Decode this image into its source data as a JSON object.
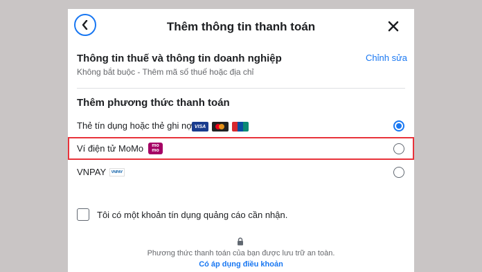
{
  "dialog": {
    "title": "Thêm thông tin thanh toán"
  },
  "tax_section": {
    "title": "Thông tin thuế và thông tin doanh nghiệp",
    "subtitle": "Không bắt buộc - Thêm mã số thuế hoặc địa chỉ",
    "edit_label": "Chỉnh sửa"
  },
  "payment_section": {
    "title": "Thêm phương thức thanh toán",
    "options": [
      {
        "label": "Thẻ tín dụng hoặc thẻ ghi nợ",
        "selected": true,
        "logos": [
          "VISA",
          "mastercard-logo",
          "UnionPay"
        ]
      },
      {
        "label": "Ví điện tử MoMo",
        "selected": false,
        "logo_text": "mo mo"
      },
      {
        "label": "VNPAY",
        "selected": false,
        "logo_text": "VNPAY"
      }
    ]
  },
  "credit_checkbox": {
    "label": "Tôi có một khoản tín dụng quảng cáo cần nhận.",
    "checked": false
  },
  "footer": {
    "note": "Phương thức thanh toán của bạn được lưu trữ an toàn.",
    "terms_link": "Có áp dụng điều khoản"
  },
  "colors": {
    "accent": "#1877f2",
    "highlight_border": "#e8323a",
    "momo": "#a50064",
    "backdrop": "#c9c5c5"
  }
}
